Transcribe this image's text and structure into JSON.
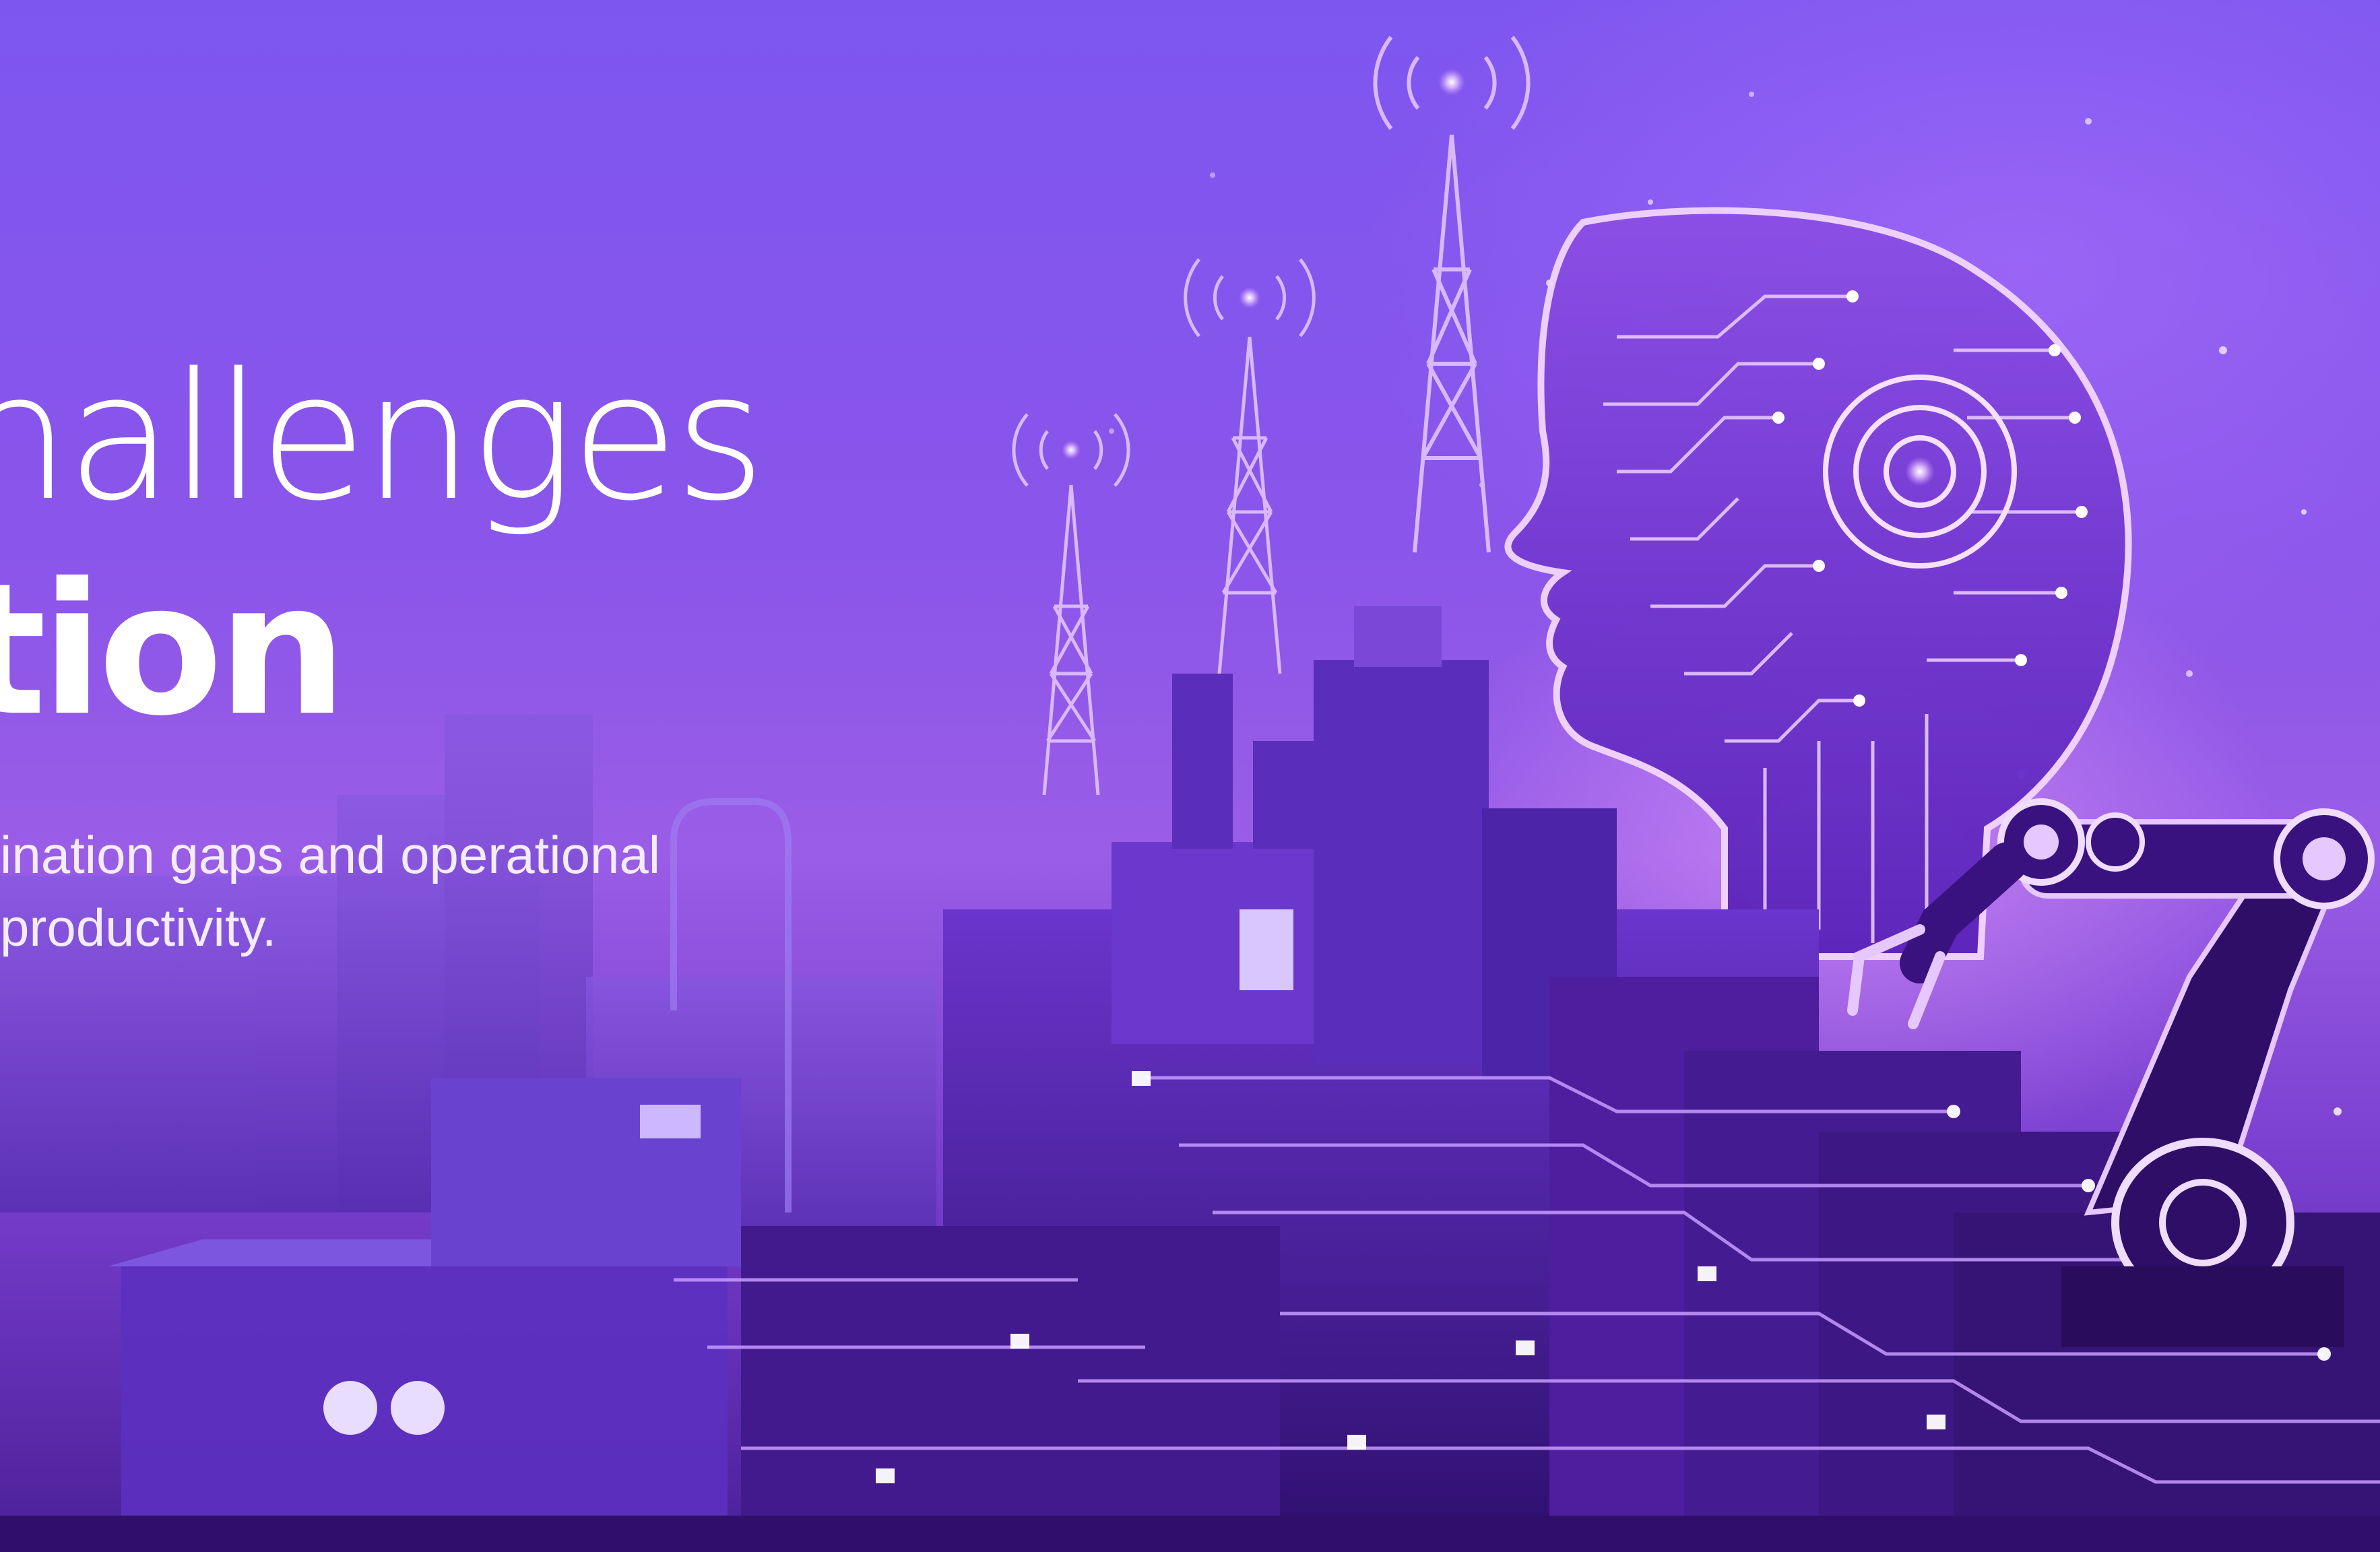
{
  "hero": {
    "headline_line1": "hallenges",
    "headline_line2": "tion",
    "subtitle_line1": "ination gaps and operational",
    "subtitle_line2": "productivity."
  },
  "colors": {
    "background": "#7d56f0",
    "accent_glow": "#e6a0ff",
    "structure": "#4a1f9a",
    "text": "#ffffff"
  },
  "illustration": {
    "icons": [
      "signal-tower-icon",
      "ai-head-icon",
      "robotic-arm-icon",
      "factory-icon",
      "circuit-lines"
    ]
  }
}
